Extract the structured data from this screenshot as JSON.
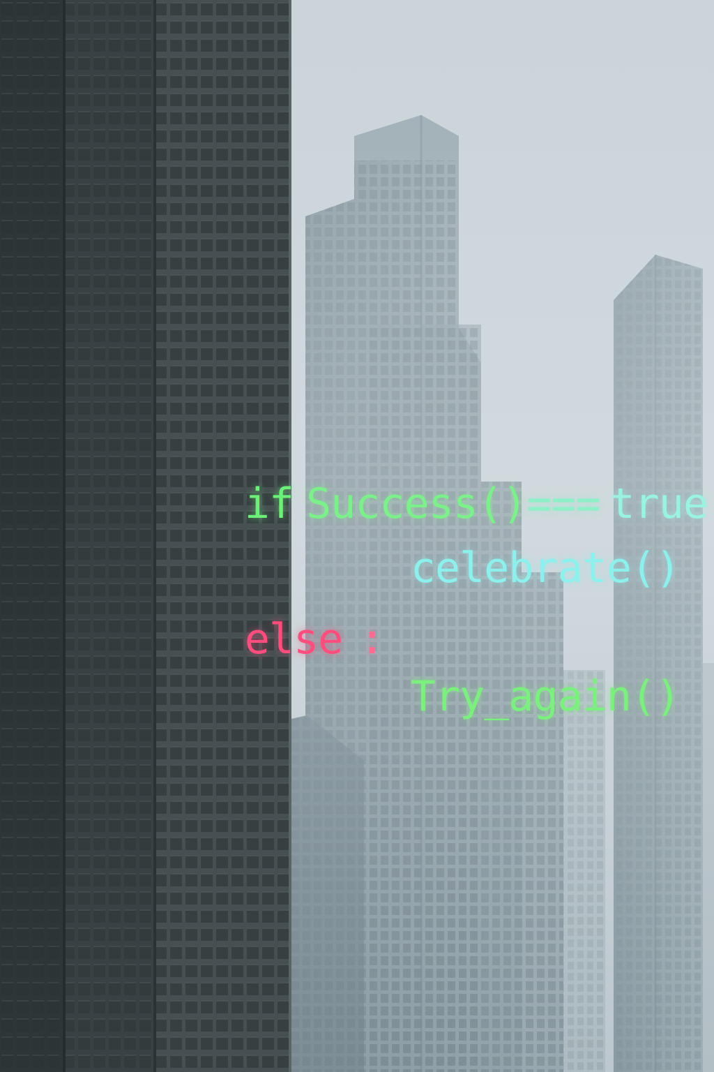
{
  "code": {
    "line1": {
      "keyword_if": "if",
      "call_success": "Success()",
      "operator": "===",
      "literal_true": "true",
      "colon": ":"
    },
    "line2": {
      "call_celebrate": "celebrate()"
    },
    "line3": {
      "keyword_else": "else",
      "colon": ":"
    },
    "line4": {
      "call_try_again": "Try_again()"
    }
  },
  "colors": {
    "green": "#6cf07a",
    "cyan": "#8ef0e6",
    "pink": "#ff4d7d",
    "sky": "#cfd9de",
    "tower_dark": "#3c4547",
    "tower_mid": "#7c8f98",
    "tower_far": "#a7b6bd"
  }
}
